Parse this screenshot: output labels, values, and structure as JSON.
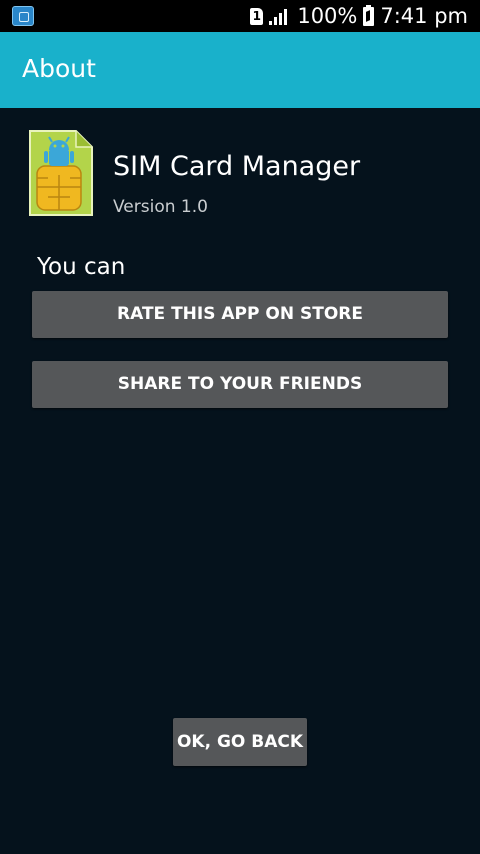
{
  "status_bar": {
    "sim_slot": "1",
    "battery_percent": "100%",
    "time": "7:41 pm",
    "colors": {
      "background": "#000000",
      "text": "#ffffff"
    }
  },
  "app_bar": {
    "title": "About",
    "color": "#19b1cb"
  },
  "app_info": {
    "name": "SIM Card Manager",
    "version": "Version 1.0",
    "icon": "sim-card-android-icon"
  },
  "actions": {
    "heading": "You can",
    "rate_label": "RATE THIS APP ON STORE",
    "share_label": "SHARE TO YOUR FRIENDS"
  },
  "footer": {
    "back_label": "OK, GO BACK"
  },
  "theme": {
    "background": "#05121c",
    "button": "#555759"
  }
}
